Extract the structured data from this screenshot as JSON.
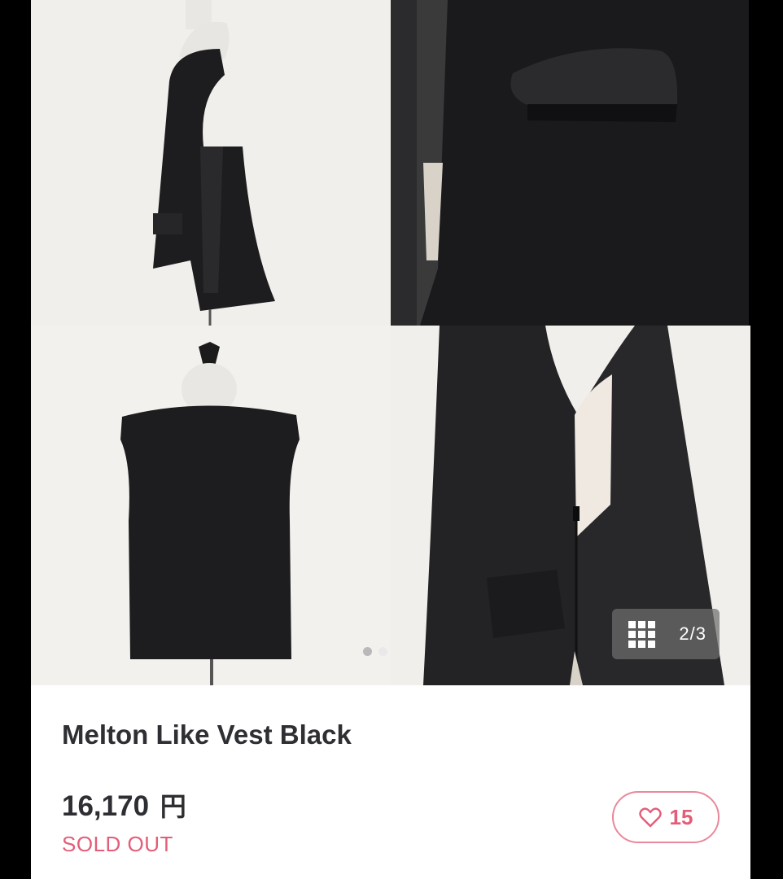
{
  "product": {
    "title": "Melton Like Vest Black",
    "price": "16,170",
    "currency": "円",
    "status": "SOLD OUT",
    "likes": "15"
  },
  "gallery": {
    "counter": "2/3",
    "page_index": 2,
    "page_total": 3,
    "grid_icon": "grid-icon"
  },
  "colors": {
    "accent": "#e35d78",
    "text": "#2e2f33",
    "garment": "#1c1c1e"
  }
}
